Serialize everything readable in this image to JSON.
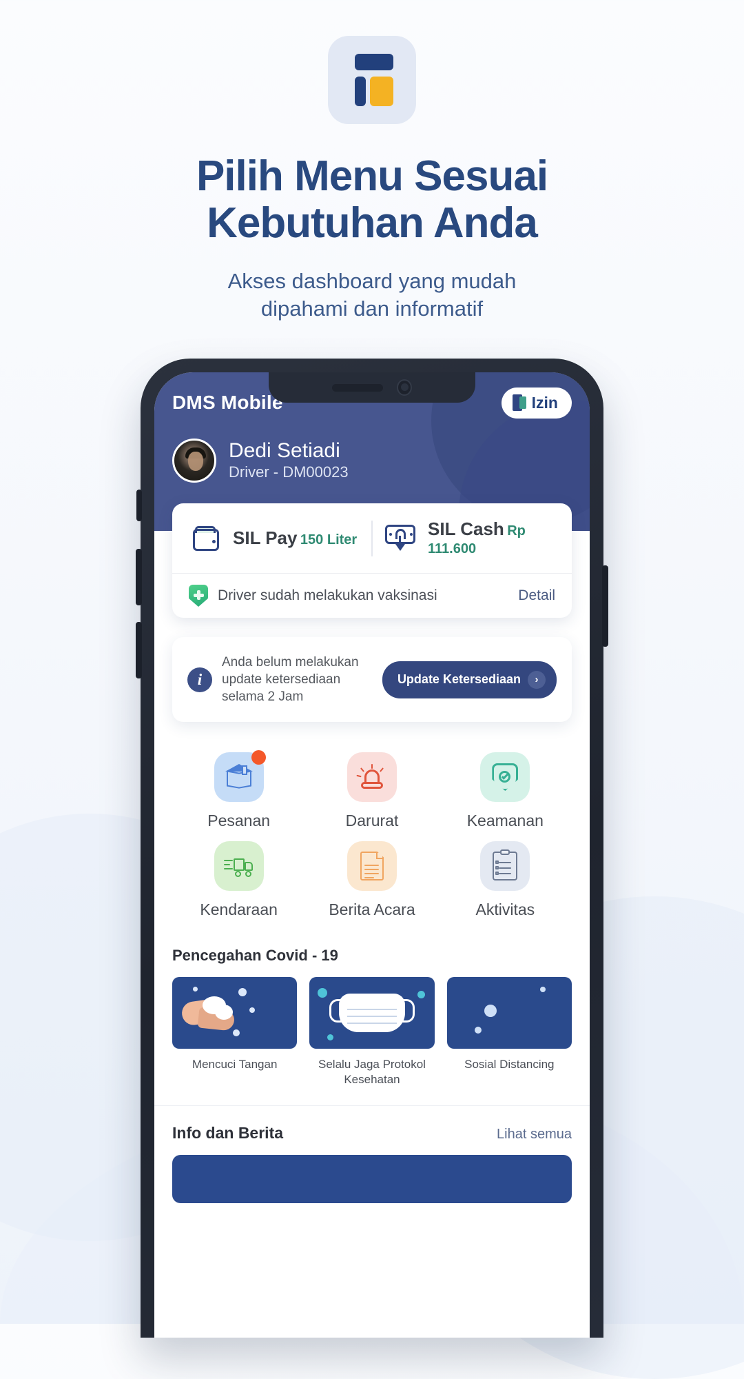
{
  "promo": {
    "headline_line1": "Pilih Menu Sesuai",
    "headline_line2": "Kebutuhan Anda",
    "subtitle_line1": "Akses dashboard yang mudah",
    "subtitle_line2": "dipahami dan informatif",
    "app_icon_name": "dashboard-layout-icon",
    "colors": {
      "navy": "#29497f",
      "brand_blue": "#22407c",
      "amber": "#f4b223"
    }
  },
  "app": {
    "title": "DMS Mobile",
    "izin_button": "Izin",
    "profile": {
      "name": "Dedi Setiadi",
      "role": "Driver - DM00023"
    },
    "balance": {
      "left": {
        "title": "SIL Pay",
        "value": "150 Liter",
        "icon": "wallet-icon"
      },
      "right": {
        "title": "SIL Cash",
        "value": "Rp 111.600",
        "icon": "cash-withdraw-icon"
      }
    },
    "vaccination": {
      "text": "Driver sudah melakukan vaksinasi",
      "link": "Detail",
      "icon": "shield-health-icon"
    },
    "update_banner": {
      "message": "Anda belum melakukan update ketersediaan selama 2 Jam",
      "button": "Update Ketersediaan",
      "icon": "info-icon",
      "chevron": "›"
    },
    "menu": [
      {
        "label": "Pesanan",
        "icon": "box-icon",
        "badge": true
      },
      {
        "label": "Darurat",
        "icon": "siren-icon",
        "badge": false
      },
      {
        "label": "Keamanan",
        "icon": "shield-check-icon",
        "badge": false
      },
      {
        "label": "Kendaraan",
        "icon": "truck-icon",
        "badge": false
      },
      {
        "label": "Berita Acara",
        "icon": "document-icon",
        "badge": false
      },
      {
        "label": "Aktivitas",
        "icon": "clipboard-icon",
        "badge": false
      }
    ],
    "covid": {
      "title": "Pencegahan Covid - 19",
      "items": [
        {
          "caption": "Mencuci Tangan",
          "art": "washing-hands-art"
        },
        {
          "caption": "Selalu Jaga Protokol Kesehatan",
          "art": "face-mask-art"
        },
        {
          "caption": "Sosial Distancing",
          "art": "social-distancing-art"
        }
      ]
    },
    "news": {
      "title": "Info dan Berita",
      "see_all": "Lihat semua"
    }
  }
}
